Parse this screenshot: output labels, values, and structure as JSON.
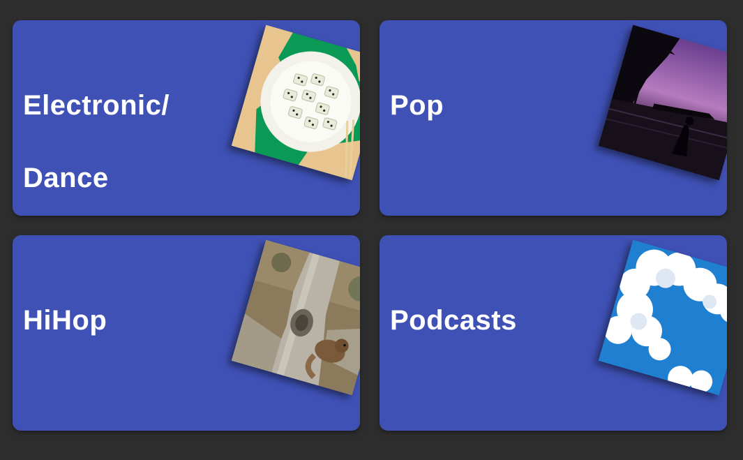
{
  "categories": [
    {
      "label_lines": [
        "Electronic/",
        "Dance"
      ],
      "art": "sushi-plate-image",
      "color": "#3f51b5"
    },
    {
      "label_lines": [
        "Pop"
      ],
      "art": "palm-sunset-silhouette-image",
      "color": "#3f51b5"
    },
    {
      "label_lines": [
        "HiHop"
      ],
      "art": "squirrel-tree-image",
      "color": "#3f51b5"
    },
    {
      "label_lines": [
        "Podcasts"
      ],
      "art": "cloudy-sky-image",
      "color": "#3f51b5"
    }
  ],
  "background_color": "#2d2d2d"
}
